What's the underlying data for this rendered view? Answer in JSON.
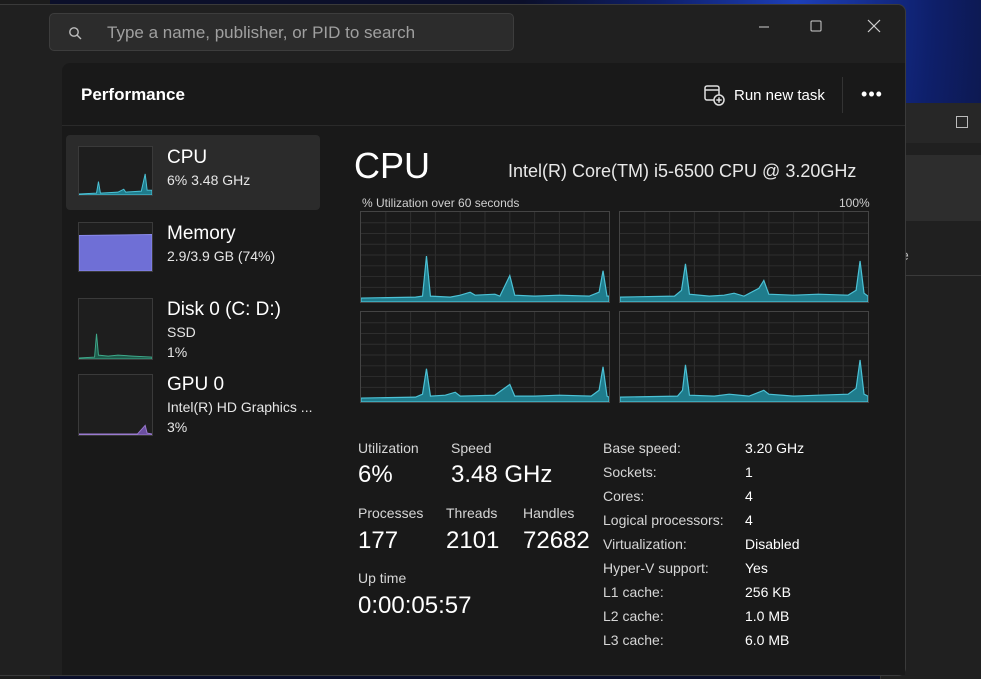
{
  "search": {
    "placeholder": "Type a name, publisher, or PID to search"
  },
  "header": {
    "title": "Performance",
    "run_task_label": "Run new task",
    "more_label": "•••"
  },
  "window_controls": {
    "minimize": "—",
    "maximize": "☐",
    "close": "✕"
  },
  "sidebar": {
    "items": [
      {
        "title": "CPU",
        "sub": "6%  3.48 GHz",
        "sub2": ""
      },
      {
        "title": "Memory",
        "sub": "2.9/3.9 GB (74%)",
        "sub2": ""
      },
      {
        "title": "Disk 0 (C: D:)",
        "sub": "SSD",
        "sub2": "1%"
      },
      {
        "title": "GPU 0",
        "sub": "Intel(R) HD Graphics ...",
        "sub2": "3%"
      }
    ]
  },
  "main": {
    "title": "CPU",
    "model": "Intel(R) Core(TM) i5-6500 CPU @ 3.20GHz",
    "graph_caption": "% Utilization over 60 seconds",
    "graph_max": "100%",
    "stats": {
      "utilization_label": "Utilization",
      "utilization": "6%",
      "speed_label": "Speed",
      "speed": "3.48 GHz",
      "processes_label": "Processes",
      "processes": "177",
      "threads_label": "Threads",
      "threads": "2101",
      "handles_label": "Handles",
      "handles": "72682",
      "uptime_label": "Up time",
      "uptime": "0:00:05:57"
    },
    "specs": [
      {
        "label": "Base speed:",
        "value": "3.20 GHz"
      },
      {
        "label": "Sockets:",
        "value": "1"
      },
      {
        "label": "Cores:",
        "value": "4"
      },
      {
        "label": "Logical processors:",
        "value": "4"
      },
      {
        "label": "Virtualization:",
        "value": "Disabled"
      },
      {
        "label": "Hyper-V support:",
        "value": "Yes"
      },
      {
        "label": "L1 cache:",
        "value": "256 KB"
      },
      {
        "label": "L2 cache:",
        "value": "1.0 MB"
      },
      {
        "label": "L3 cache:",
        "value": "6.0 MB"
      }
    ]
  },
  "colors": {
    "cpu_line": "#4cc2d6",
    "cpu_fill": "#1f7c8c",
    "memory_fill": "#6f6fd6",
    "disk_line": "#3fa88a"
  }
}
